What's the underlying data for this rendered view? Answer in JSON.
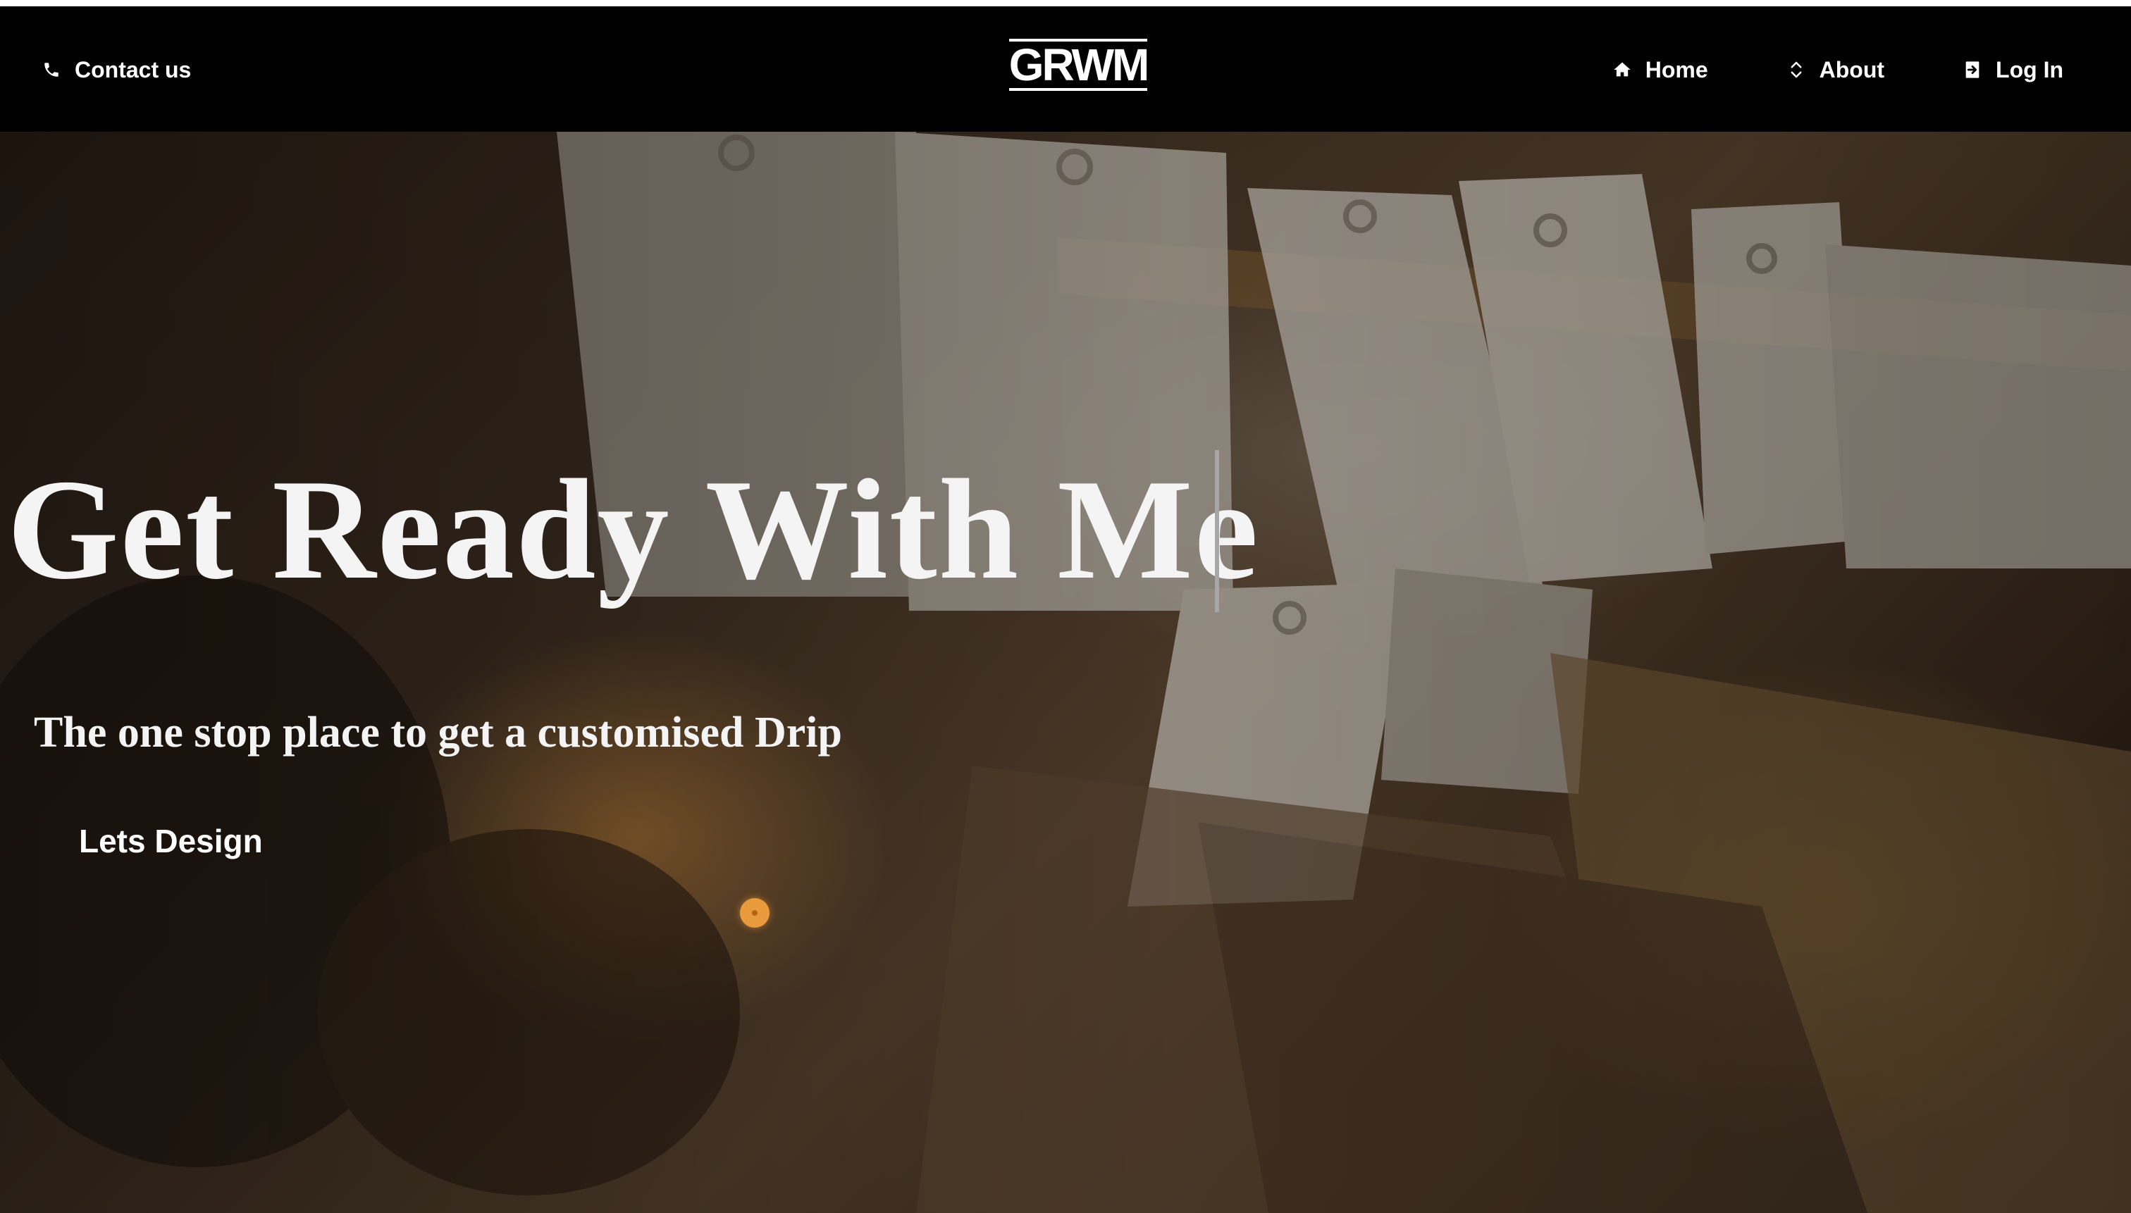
{
  "nav": {
    "contact_label": "Contact us",
    "logo_text": "GRWM",
    "home_label": "Home",
    "about_label": "About",
    "login_label": "Log In"
  },
  "hero": {
    "title": "Get Ready With Me",
    "subtitle": "The one stop place to get a customised Drip",
    "cta_label": "Lets Design"
  },
  "colors": {
    "nav_background": "#000000",
    "text_primary": "#f4f4f4",
    "cursor_accent": "#e89a3c"
  },
  "icons": {
    "contact": "phone-icon",
    "home": "home-icon",
    "about": "chevron-up-down-icon",
    "login": "login-icon"
  }
}
